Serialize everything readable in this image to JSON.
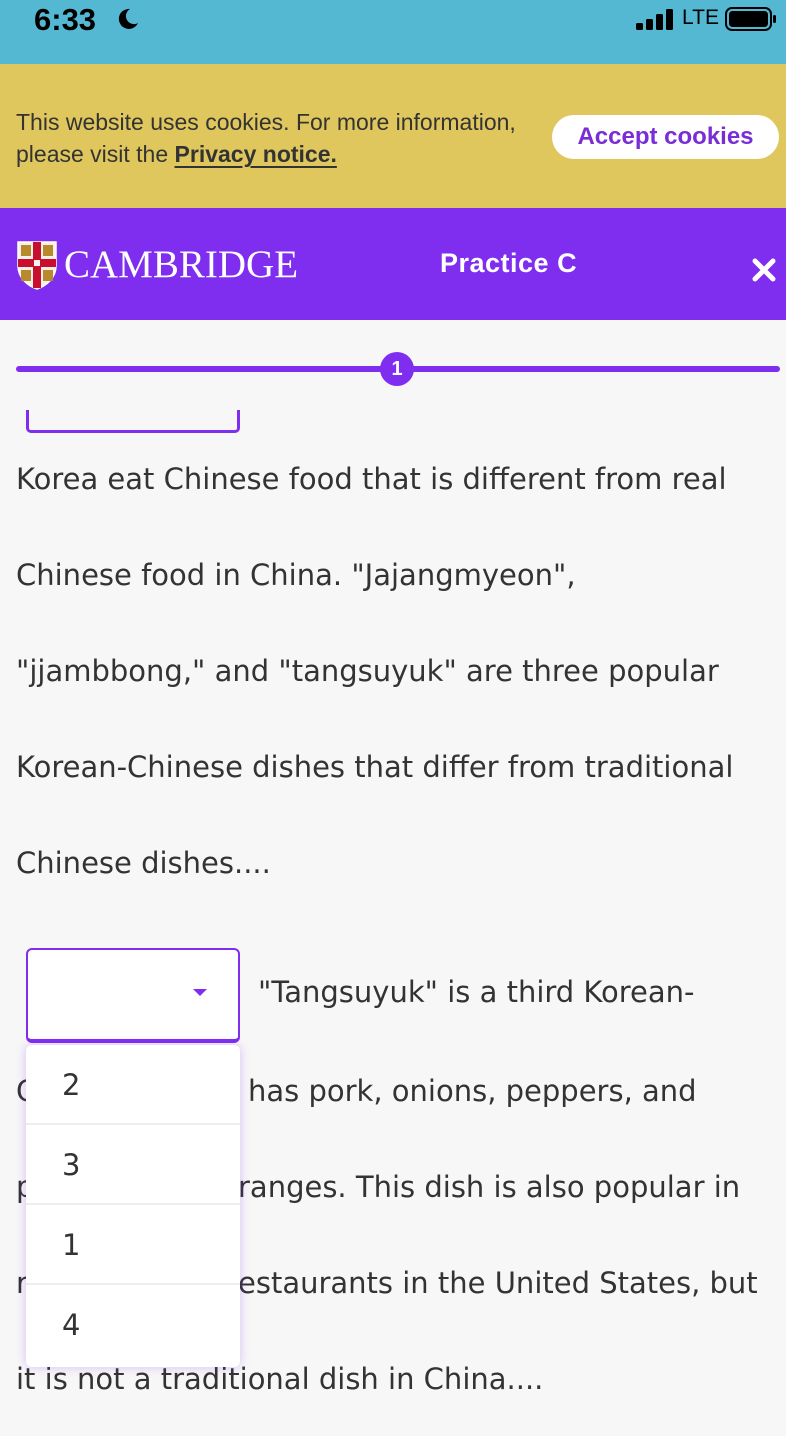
{
  "status_bar": {
    "time": "6:33",
    "network": "LTE"
  },
  "cookie_banner": {
    "text": "This website uses cookies. For more information, please visit the",
    "link": "Privacy notice.",
    "accept_label": "Accept cookies"
  },
  "header": {
    "brand": "CAMBRIDGE",
    "title": "Practice C"
  },
  "progress": {
    "current": "1"
  },
  "passage": {
    "lines": [
      "Korea eat Chinese food that is different from real",
      "Chinese food in China. \"Jajangmyeon\",",
      "\"jjambbong,\" and \"tangsuyuk\" are three popular",
      "Korean-Chinese dishes that differ from traditional",
      "Chinese dishes....",
      "\"Tangsuyuk\" is a third Korean-",
      "C",
      "has pork, onions, peppers, and",
      "p",
      "ranges. This dish is also popular in",
      "r",
      "estaurants in the United States, but",
      "it is not a traditional dish in China...."
    ]
  },
  "dropdown": {
    "selected": "",
    "options": [
      "2",
      "3",
      "1",
      "4"
    ]
  },
  "colors": {
    "status_bar": "#55b8d3",
    "cookie_banner": "#dfc75e",
    "brand_purple": "#7f2ef0",
    "background": "#f7f7f7"
  },
  "icons": [
    "moon-icon",
    "signal-icon",
    "battery-icon",
    "shield-icon",
    "close-icon",
    "chevron-down-icon"
  ]
}
